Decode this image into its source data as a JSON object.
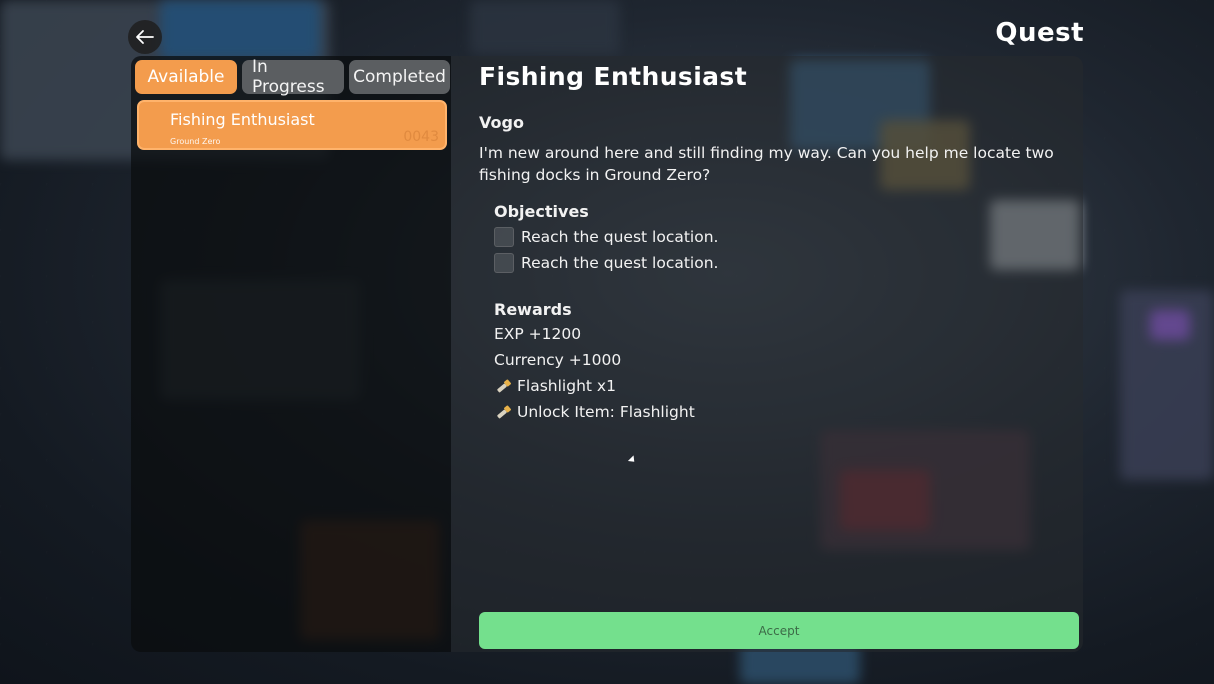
{
  "header": {
    "title": "Quest",
    "back_icon": "arrow-left-icon"
  },
  "tabs": [
    {
      "label": "Available",
      "active": true
    },
    {
      "label": "In Progress",
      "active": false
    },
    {
      "label": "Completed",
      "active": false
    }
  ],
  "quest_list": [
    {
      "name": "Fishing Enthusiast",
      "location": "Ground Zero",
      "id": "0043"
    }
  ],
  "detail": {
    "title": "Fishing Enthusiast",
    "giver": "Vogo",
    "description": "I'm new around here and still finding my way. Can you help me locate two fishing docks in Ground Zero?",
    "objectives_heading": "Objectives",
    "objectives": [
      {
        "text": "Reach the quest location.",
        "done": false
      },
      {
        "text": "Reach the quest location.",
        "done": false
      }
    ],
    "rewards_heading": "Rewards",
    "rewards": [
      {
        "text": "EXP +1200",
        "icon": null
      },
      {
        "text": "Currency +1000",
        "icon": null
      },
      {
        "text": "Flashlight x1",
        "icon": "flashlight-icon"
      },
      {
        "text": "Unlock Item: Flashlight",
        "icon": "flashlight-icon"
      }
    ],
    "accept_label": "Accept"
  },
  "colors": {
    "accent_orange": "#f39c4d",
    "tab_inactive": "#5b5e61",
    "accept_green": "#74e08d"
  }
}
